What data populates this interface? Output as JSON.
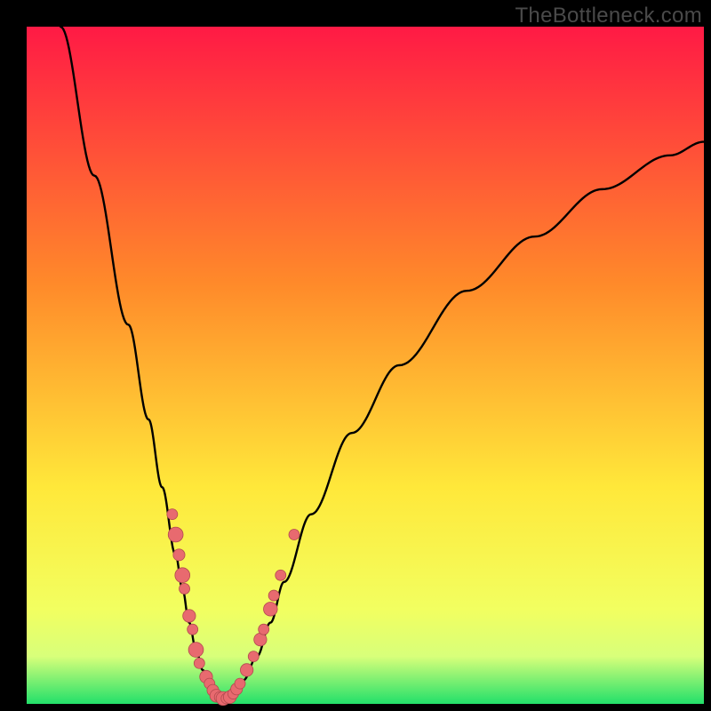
{
  "watermark": "TheBottleneck.com",
  "gradient": {
    "top": "#ff1a45",
    "mid1": "#ff8a2a",
    "mid2": "#ffe83a",
    "low": "#f2ff60",
    "band": "#d8ff7a",
    "bottom": "#22e06a"
  },
  "curve_color": "#000000",
  "dot_fill": "#e86a6f",
  "dot_stroke": "#b24a4f",
  "chart_data": {
    "type": "line",
    "title": "",
    "xlabel": "",
    "ylabel": "",
    "xlim": [
      0,
      100
    ],
    "ylim": [
      0,
      100
    ],
    "series": [
      {
        "name": "left-branch",
        "x": [
          5,
          10,
          15,
          18,
          20,
          22,
          23,
          24,
          25,
          26,
          27,
          28,
          29
        ],
        "values": [
          100,
          78,
          56,
          42,
          32,
          22,
          17,
          12,
          8,
          5,
          3,
          1.5,
          0.8
        ]
      },
      {
        "name": "right-branch",
        "x": [
          29,
          30,
          31,
          32,
          34,
          36,
          38,
          42,
          48,
          55,
          65,
          75,
          85,
          95,
          100
        ],
        "values": [
          0.8,
          1.2,
          2,
          3.5,
          7,
          12,
          18,
          28,
          40,
          50,
          61,
          69,
          76,
          81,
          83
        ]
      }
    ],
    "scatter": [
      {
        "x": 21.5,
        "y": 28,
        "r": 1.0
      },
      {
        "x": 22.0,
        "y": 25,
        "r": 1.4
      },
      {
        "x": 22.5,
        "y": 22,
        "r": 1.1
      },
      {
        "x": 23.0,
        "y": 19,
        "r": 1.4
      },
      {
        "x": 23.3,
        "y": 17,
        "r": 1.0
      },
      {
        "x": 24.0,
        "y": 13,
        "r": 1.2
      },
      {
        "x": 24.5,
        "y": 11,
        "r": 1.0
      },
      {
        "x": 25.0,
        "y": 8,
        "r": 1.4
      },
      {
        "x": 25.5,
        "y": 6,
        "r": 1.0
      },
      {
        "x": 26.5,
        "y": 4,
        "r": 1.2
      },
      {
        "x": 27.0,
        "y": 3,
        "r": 1.0
      },
      {
        "x": 27.5,
        "y": 2,
        "r": 1.1
      },
      {
        "x": 28.0,
        "y": 1.2,
        "r": 1.2
      },
      {
        "x": 28.5,
        "y": 1.0,
        "r": 1.0
      },
      {
        "x": 29.0,
        "y": 0.8,
        "r": 1.3
      },
      {
        "x": 29.5,
        "y": 0.8,
        "r": 1.0
      },
      {
        "x": 30.0,
        "y": 1.0,
        "r": 1.2
      },
      {
        "x": 30.5,
        "y": 1.5,
        "r": 1.0
      },
      {
        "x": 31.0,
        "y": 2.2,
        "r": 1.1
      },
      {
        "x": 31.5,
        "y": 3.0,
        "r": 1.0
      },
      {
        "x": 32.5,
        "y": 5.0,
        "r": 1.2
      },
      {
        "x": 33.5,
        "y": 7.0,
        "r": 1.0
      },
      {
        "x": 34.5,
        "y": 9.5,
        "r": 1.2
      },
      {
        "x": 35.0,
        "y": 11,
        "r": 1.0
      },
      {
        "x": 36.0,
        "y": 14,
        "r": 1.3
      },
      {
        "x": 36.5,
        "y": 16,
        "r": 1.0
      },
      {
        "x": 37.5,
        "y": 19,
        "r": 1.0
      },
      {
        "x": 39.5,
        "y": 25,
        "r": 1.0
      }
    ]
  }
}
